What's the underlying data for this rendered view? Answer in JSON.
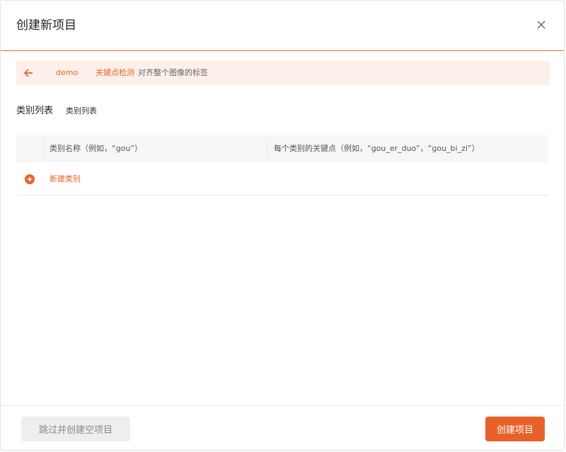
{
  "dialog": {
    "title": "创建新项目",
    "close_icon": "close-icon"
  },
  "breadcrumb": {
    "back_icon": "arrow-left-icon",
    "project_name": "demo",
    "project_type": "关键点检测",
    "type_description": "对齐整个图像的标签"
  },
  "category_section": {
    "title": "类别列表",
    "subtitle": "类别列表",
    "columns": [
      "类别名称（例如，“gou”）",
      "每个类别的关键点（例如，“gou_er_duo”，“gou_bi_zi”）"
    ],
    "add_icon": "plus-circle-icon",
    "add_label": "新建类别"
  },
  "footer": {
    "skip_label": "跳过并创建空项目",
    "create_label": "创建项目"
  },
  "colors": {
    "accent": "#e9612a",
    "accent_light": "#fdf0eb",
    "border": "#e8e8e8"
  }
}
